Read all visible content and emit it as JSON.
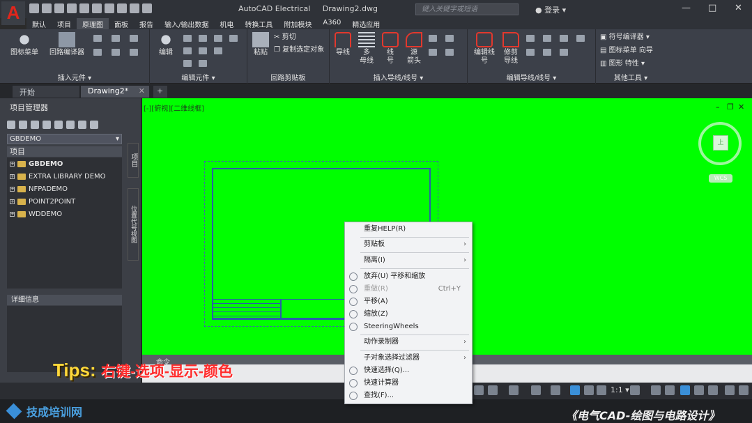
{
  "app": {
    "logo": "A",
    "title": "AutoCAD Electrical",
    "document": "Drawing2.dwg",
    "search_placeholder": "键入关键字或短语",
    "login": "登录"
  },
  "menu": [
    "默认",
    "项目",
    "原理图",
    "面板",
    "报告",
    "输入/输出数据",
    "机电",
    "转换工具",
    "附加模块",
    "A360",
    "精选应用"
  ],
  "ribbon": {
    "groups": [
      "插入元件 ▾",
      "编辑元件 ▾",
      "回路剪贴板",
      "插入导线/线号 ▾",
      "编辑导线/线号 ▾",
      "其他工具 ▾"
    ],
    "buttons": {
      "icon_menu": "图标菜单",
      "circuit_builder": "回路编译器",
      "edit": "编辑",
      "paste": "粘贴",
      "cut": "剪切",
      "copy_selected": "复制选定对象",
      "wire": "导线",
      "multi_bus_1": "多",
      "multi_bus_2": "母线",
      "wire_number_1": "线",
      "wire_number_2": "号",
      "source_arrow_1": "源",
      "source_arrow_2": "箭头",
      "edit_wire_1": "编辑线",
      "edit_wire_2": "号",
      "trim_wire_1": "修剪",
      "trim_wire_2": "导线",
      "symbol_builder": "符号编译器",
      "icon_menu_wizard": "图标菜单 向导",
      "graphic_properties": "图形 特性"
    }
  },
  "tabs": [
    "开始",
    "Drawing2*"
  ],
  "project_manager": {
    "title": "项目管理器",
    "current_project": "GBDEMO",
    "list_header": "项目",
    "projects": [
      "GBDEMO",
      "EXTRA LIBRARY DEMO",
      "NFPADEMO",
      "POINT2POINT",
      "WDDEMO"
    ],
    "details_header": "详细信息",
    "side_tab_1": "项目",
    "side_tab_2": "位置代号视图"
  },
  "viewport": {
    "label": "[-][俯视][二维线框]",
    "wcs": "WCS",
    "cube_face": "上"
  },
  "context_menu": {
    "items": [
      {
        "label": "重复HELP(R)",
        "disabled": false,
        "submenu": false,
        "shortcut": "",
        "icon": false
      },
      {
        "label": "剪贴板",
        "disabled": false,
        "submenu": true,
        "shortcut": "",
        "icon": false
      },
      {
        "label": "隔离(I)",
        "disabled": false,
        "submenu": true,
        "shortcut": "",
        "icon": false
      },
      {
        "label": "放弃(U) 平移和缩放",
        "disabled": false,
        "submenu": false,
        "shortcut": "",
        "icon": true
      },
      {
        "label": "重做(R)",
        "disabled": true,
        "submenu": false,
        "shortcut": "Ctrl+Y",
        "icon": true
      },
      {
        "label": "平移(A)",
        "disabled": false,
        "submenu": false,
        "shortcut": "",
        "icon": true
      },
      {
        "label": "缩放(Z)",
        "disabled": false,
        "submenu": false,
        "shortcut": "",
        "icon": true
      },
      {
        "label": "SteeringWheels",
        "disabled": false,
        "submenu": false,
        "shortcut": "",
        "icon": true
      },
      {
        "label": "动作录制器",
        "disabled": false,
        "submenu": true,
        "shortcut": "",
        "icon": false
      },
      {
        "label": "子对象选择过滤器",
        "disabled": false,
        "submenu": true,
        "shortcut": "",
        "icon": false
      },
      {
        "label": "快速选择(Q)...",
        "disabled": false,
        "submenu": false,
        "shortcut": "",
        "icon": true
      },
      {
        "label": "快速计算器",
        "disabled": false,
        "submenu": false,
        "shortcut": "",
        "icon": true
      },
      {
        "label": "查找(F)...",
        "disabled": false,
        "submenu": false,
        "shortcut": "",
        "icon": true
      }
    ]
  },
  "command_line": {
    "prompt": "命令"
  },
  "statusbar": {
    "scale": "1:1"
  },
  "overlay": {
    "tips_label": "Tips:",
    "tips_text": "右键-选项-显示-颜色",
    "brand": "技成培训网",
    "course": "《电气CAD-绘图与电路设计》"
  },
  "colors": {
    "canvas": "#00ff00",
    "tips": "#ffd83a",
    "tips_text": "#ff2b2b",
    "app_logo": "#e0261c"
  }
}
